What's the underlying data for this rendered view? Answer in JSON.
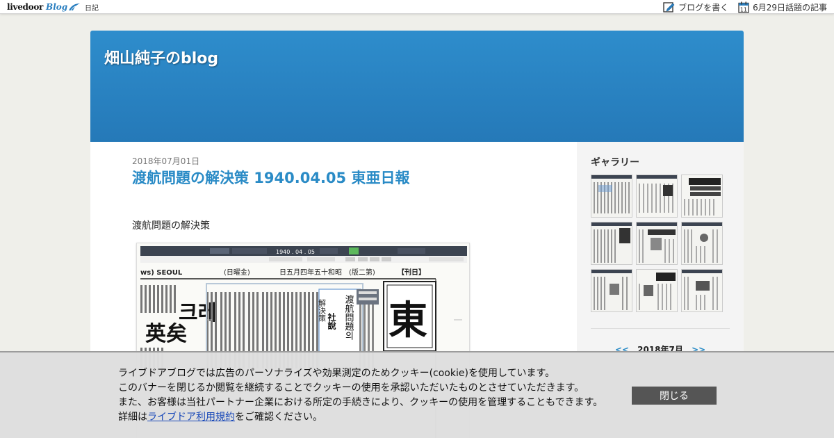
{
  "topbar": {
    "logo_text": "livedoor",
    "logo_blog": "Blog",
    "diary_label": "日記",
    "write_blog_label": "ブログを書く",
    "calendar_icon_day": "11",
    "topic_label": "6月29日話題の記事"
  },
  "blog": {
    "title": "畑山純子のblog"
  },
  "post": {
    "date": "2018年07月01日",
    "title": "渡航問題の解決策 1940.04.05 東亜日報",
    "body_text": "渡航問題の解決策"
  },
  "newspaper": {
    "toolbar_date": "1940 . 04 . 05",
    "masthead_left": "ws) SEOUL",
    "masthead_day": "(日曜金)",
    "masthead_date": "日五月四年五十和昭",
    "masthead_issue": "(版二第)",
    "masthead_page": "【刊日】",
    "col_label": "社說",
    "headline_big": "渡航問題의",
    "headline_small": "解決策",
    "big_char": "東",
    "left_headline_1": "크레",
    "left_headline_2": "英矣"
  },
  "sidebar": {
    "gallery_title": "ギャラリー",
    "calendar_prev": "<<",
    "calendar_month": "2018年7月",
    "calendar_next": ">>"
  },
  "cookie": {
    "line1": "ライブドアブログでは広告のパーソナライズや効果測定のためクッキー(cookie)を使用しています。",
    "line2": "このバナーを閉じるか閲覧を継続することでクッキーの使用を承認いただいたものとさせていただきます。",
    "line3": "また、お客様は当社パートナー企業における所定の手続きにより、クッキーの使用を管理することもできます。",
    "line4_prefix": "詳細は",
    "line4_link": "ライブドア利用規約",
    "line4_suffix": "をご確認ください。",
    "close_label": "閉じる"
  },
  "colors": {
    "header_blue": "#2a86c6",
    "title_blue": "#2a8bc6",
    "close_button": "#555555"
  }
}
